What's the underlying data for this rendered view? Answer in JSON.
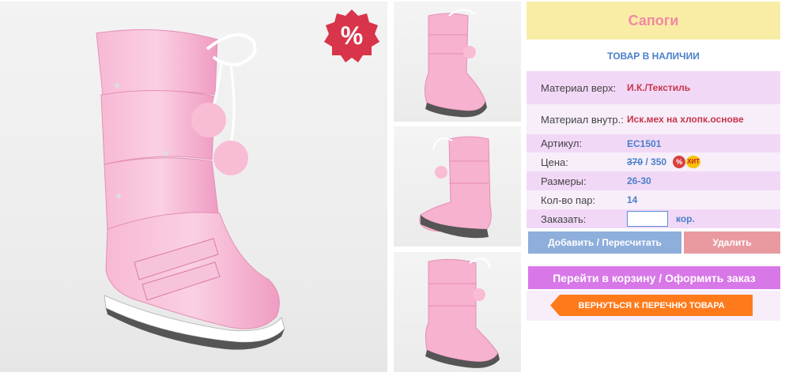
{
  "product": {
    "title": "Сапоги",
    "stock_status": "ТОВАР В НАЛИЧИИ"
  },
  "details": {
    "material_top_label": "Материал верх:",
    "material_top_value": "И.К./Текстиль",
    "material_inner_label": "Материал внутр.:",
    "material_inner_value": "Иск.мех на хлопк.основе",
    "article_label": "Артикул:",
    "article_value": "EC1501",
    "price_label": "Цена:",
    "price_old": "370",
    "price_separator": " / ",
    "price_new": "350",
    "sizes_label": "Размеры:",
    "sizes_value": "26-30",
    "pairs_label": "Кол-во пар:",
    "pairs_value": "14",
    "order_label": "Заказать:",
    "order_value": "",
    "order_unit": "кор."
  },
  "badges": {
    "sale_symbol": "%",
    "discount_symbol": "%",
    "hit_label": "ХИТ"
  },
  "buttons": {
    "add_recalc": "Добавить / Пересчитать",
    "delete": "Удалить",
    "go_cart": "Перейти в корзину / Оформить заказ",
    "back_to_list": "ВЕРНУТЬСЯ К ПЕРЕЧНЮ ТОВАРА"
  },
  "colors": {
    "title_bg": "#f9eda6",
    "title_text": "#f08aa0",
    "accent_blue": "#4a7fc9",
    "accent_red": "#c8354a",
    "row_pink": "#f2d8f7",
    "cart_button": "#d877e8",
    "back_button": "#ff7a1a",
    "boot_pink": "#f4a6c8"
  },
  "images": {
    "main_photo": "pink-winter-boot",
    "thumbnails": [
      "pink-boot-front-view",
      "pink-boot-side-view",
      "pink-boot-angle-view"
    ]
  }
}
